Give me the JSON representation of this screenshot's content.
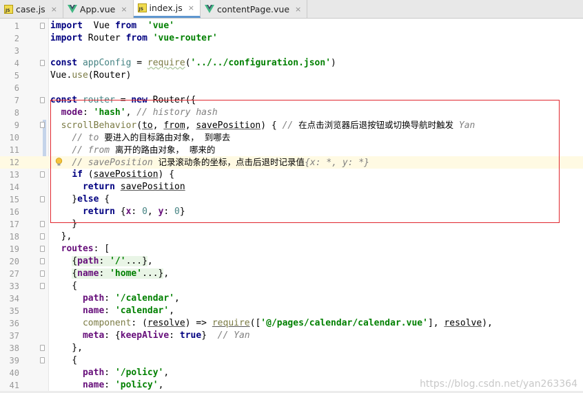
{
  "tabs": [
    {
      "label": "case.js",
      "type": "js",
      "active": false
    },
    {
      "label": "App.vue",
      "type": "vue",
      "active": false
    },
    {
      "label": "index.js",
      "type": "js",
      "active": true
    },
    {
      "label": "contentPage.vue",
      "type": "vue",
      "active": false
    }
  ],
  "close_glyph": "×",
  "lines": [
    {
      "n": "1",
      "parts": [
        [
          "kw",
          "import"
        ],
        [
          "",
          "  Vue "
        ],
        [
          "kw",
          "from"
        ],
        [
          "",
          "  "
        ],
        [
          "str",
          "'vue'"
        ]
      ]
    },
    {
      "n": "2",
      "parts": [
        [
          "kw",
          "import"
        ],
        [
          "",
          " Router "
        ],
        [
          "kw",
          "from"
        ],
        [
          "",
          " "
        ],
        [
          "str",
          "'vue-router'"
        ]
      ]
    },
    {
      "n": "3",
      "parts": []
    },
    {
      "n": "4",
      "parts": [
        [
          "kw",
          "const"
        ],
        [
          "",
          " "
        ],
        [
          "var",
          "appConfig"
        ],
        [
          "",
          " = "
        ],
        [
          "fn wavy",
          "require"
        ],
        [
          "",
          "("
        ],
        [
          "str",
          "'../../configuration.json'"
        ],
        [
          "",
          ")"
        ]
      ]
    },
    {
      "n": "5",
      "parts": [
        [
          "",
          "Vue."
        ],
        [
          "fn",
          "use"
        ],
        [
          "",
          "(Router)"
        ]
      ]
    },
    {
      "n": "6",
      "parts": []
    },
    {
      "n": "7",
      "parts": [
        [
          "kw",
          "const"
        ],
        [
          "",
          " "
        ],
        [
          "var",
          "router"
        ],
        [
          "",
          " = "
        ],
        [
          "kw",
          "new"
        ],
        [
          "",
          " Router({"
        ]
      ]
    },
    {
      "n": "8",
      "parts": [
        [
          "",
          "  "
        ],
        [
          "prop",
          "mode"
        ],
        [
          "",
          ": "
        ],
        [
          "str",
          "'hash'"
        ],
        [
          "",
          ", "
        ],
        [
          "cm",
          "// history hash"
        ]
      ]
    },
    {
      "n": "9",
      "parts": [
        [
          "",
          "  "
        ],
        [
          "fn",
          "scrollBehavior"
        ],
        [
          "",
          "("
        ],
        [
          "under",
          "to"
        ],
        [
          "",
          ", "
        ],
        [
          "under",
          "from"
        ],
        [
          "",
          ", "
        ],
        [
          "under",
          "savePosition"
        ],
        [
          "",
          ") { "
        ],
        [
          "cm",
          "// "
        ],
        [
          "cmz",
          "在点击浏览器后退按钮或切换导航时触发"
        ],
        [
          "cm",
          " Yan"
        ]
      ]
    },
    {
      "n": "10",
      "parts": [
        [
          "",
          "    "
        ],
        [
          "cm",
          "// to "
        ],
        [
          "cmz",
          "要进入的目标路由对象，  到哪去"
        ]
      ]
    },
    {
      "n": "11",
      "parts": [
        [
          "",
          "    "
        ],
        [
          "cm",
          "// from "
        ],
        [
          "cmz",
          "离开的路由对象，  哪来的"
        ]
      ]
    },
    {
      "n": "12",
      "parts": [
        [
          "",
          "    "
        ],
        [
          "cm",
          "// savePosition "
        ],
        [
          "cmz",
          "记录滚动条的坐标，点击后退时记录值"
        ],
        [
          "cm",
          "{x: *, y: *}"
        ]
      ]
    },
    {
      "n": "13",
      "parts": [
        [
          "",
          "    "
        ],
        [
          "kw",
          "if"
        ],
        [
          "",
          " ("
        ],
        [
          "under",
          "savePosition"
        ],
        [
          "",
          ") {"
        ]
      ]
    },
    {
      "n": "14",
      "parts": [
        [
          "",
          "      "
        ],
        [
          "kw",
          "return"
        ],
        [
          "",
          " "
        ],
        [
          "under",
          "savePosition"
        ]
      ]
    },
    {
      "n": "15",
      "parts": [
        [
          "",
          "    }"
        ],
        [
          "kw",
          "else"
        ],
        [
          "",
          " {"
        ]
      ]
    },
    {
      "n": "16",
      "parts": [
        [
          "",
          "      "
        ],
        [
          "kw",
          "return"
        ],
        [
          "",
          " {"
        ],
        [
          "prop",
          "x"
        ],
        [
          "",
          ": "
        ],
        [
          "var",
          "0"
        ],
        [
          "",
          ", "
        ],
        [
          "prop",
          "y"
        ],
        [
          "",
          ": "
        ],
        [
          "var",
          "0"
        ],
        [
          "",
          "}"
        ]
      ]
    },
    {
      "n": "17",
      "parts": [
        [
          "",
          "    }"
        ]
      ]
    },
    {
      "n": "18",
      "parts": [
        [
          "",
          "  },"
        ]
      ]
    },
    {
      "n": "19",
      "parts": [
        [
          "",
          "  "
        ],
        [
          "prop",
          "routes"
        ],
        [
          "",
          ": ["
        ]
      ]
    },
    {
      "n": "20",
      "parts": [
        [
          "",
          "    "
        ],
        [
          "fold-inline",
          "{"
        ],
        [
          "fold-inline prop",
          "path"
        ],
        [
          "fold-inline",
          ": "
        ],
        [
          "fold-inline str",
          "'/'"
        ],
        [
          "fold-inline",
          "...}"
        ],
        [
          "",
          ","
        ]
      ]
    },
    {
      "n": "27",
      "parts": [
        [
          "",
          "    "
        ],
        [
          "fold-inline",
          "{"
        ],
        [
          "fold-inline prop",
          "name"
        ],
        [
          "fold-inline",
          ": "
        ],
        [
          "fold-inline str",
          "'home'"
        ],
        [
          "fold-inline",
          "...}"
        ],
        [
          "",
          ","
        ]
      ]
    },
    {
      "n": "33",
      "parts": [
        [
          "",
          "    {"
        ]
      ]
    },
    {
      "n": "34",
      "parts": [
        [
          "",
          "      "
        ],
        [
          "prop",
          "path"
        ],
        [
          "",
          ": "
        ],
        [
          "str",
          "'/calendar'"
        ],
        [
          "",
          ","
        ]
      ]
    },
    {
      "n": "35",
      "parts": [
        [
          "",
          "      "
        ],
        [
          "prop",
          "name"
        ],
        [
          "",
          ": "
        ],
        [
          "str",
          "'calendar'"
        ],
        [
          "",
          ","
        ]
      ]
    },
    {
      "n": "36",
      "parts": [
        [
          "",
          "      "
        ],
        [
          "fn",
          "component"
        ],
        [
          "",
          ": ("
        ],
        [
          "under",
          "resolve"
        ],
        [
          "",
          ") => "
        ],
        [
          "fn under",
          "require"
        ],
        [
          "",
          "(["
        ],
        [
          "str",
          "'@/pages/calendar/calendar.vue'"
        ],
        [
          "",
          "], "
        ],
        [
          "under",
          "resolve"
        ],
        [
          "",
          "),"
        ]
      ]
    },
    {
      "n": "37",
      "parts": [
        [
          "",
          "      "
        ],
        [
          "prop",
          "meta"
        ],
        [
          "",
          ": {"
        ],
        [
          "prop",
          "keepAlive"
        ],
        [
          "",
          ": "
        ],
        [
          "kw",
          "true"
        ],
        [
          "",
          "}  "
        ],
        [
          "cm",
          "// Yan"
        ]
      ]
    },
    {
      "n": "38",
      "parts": [
        [
          "",
          "    },"
        ]
      ]
    },
    {
      "n": "39",
      "parts": [
        [
          "",
          "    {"
        ]
      ]
    },
    {
      "n": "40",
      "parts": [
        [
          "",
          "      "
        ],
        [
          "prop",
          "path"
        ],
        [
          "",
          ": "
        ],
        [
          "str",
          "'/policy'"
        ],
        [
          "",
          ","
        ]
      ]
    },
    {
      "n": "41",
      "parts": [
        [
          "",
          "      "
        ],
        [
          "prop",
          "name"
        ],
        [
          "",
          ": "
        ],
        [
          "str",
          "'policy'"
        ],
        [
          "",
          ","
        ]
      ]
    }
  ],
  "current_line": "12",
  "watermark": "https://blog.csdn.net/yan263364"
}
